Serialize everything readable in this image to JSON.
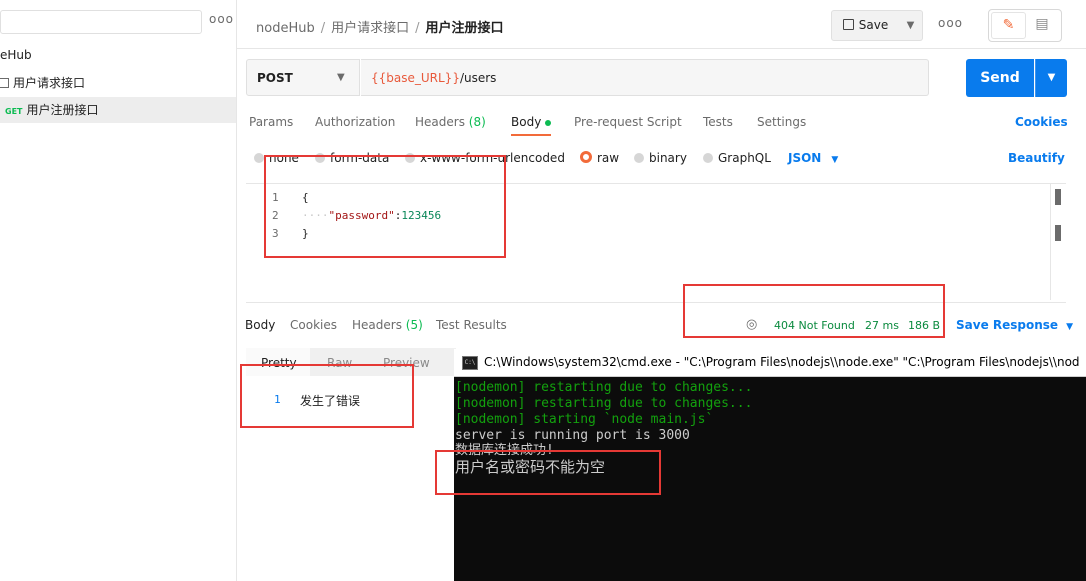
{
  "sidebar": {
    "more_label": "ooo",
    "collection_name": "eHub",
    "folder_name": "用户请求接口",
    "request": {
      "method_tag": "GET",
      "name": "用户注册接口"
    }
  },
  "header": {
    "breadcrumb": [
      "nodeHub",
      "用户请求接口",
      "用户注册接口"
    ],
    "save_label": "Save",
    "more_label": "ooo"
  },
  "request": {
    "method": "POST",
    "url_var": "{{base_URL}}",
    "url_path": "/users",
    "send_label": "Send"
  },
  "tabs": [
    {
      "label": "Params"
    },
    {
      "label": "Authorization"
    },
    {
      "label": "Headers ",
      "count": "(8)"
    },
    {
      "label": "Body"
    },
    {
      "label": "Pre-request Script"
    },
    {
      "label": "Tests"
    },
    {
      "label": "Settings"
    }
  ],
  "cookies_label": "Cookies",
  "body_types": [
    "none",
    "form-data",
    "x-www-form-urlencoded",
    "raw",
    "binary",
    "GraphQL"
  ],
  "body_format": "JSON",
  "beautify_label": "Beautify",
  "editor": {
    "line_numbers": [
      "1",
      "2",
      "3"
    ],
    "lines": {
      "open": "{",
      "indent": "····",
      "key": "\"password\"",
      "colon": ":",
      "value": "123456",
      "close": "}"
    }
  },
  "response": {
    "tabs": [
      {
        "label": "Body"
      },
      {
        "label": "Cookies"
      },
      {
        "label": "Headers ",
        "count": "(5)"
      },
      {
        "label": "Test Results"
      }
    ],
    "status": "404 Not Found",
    "time": "27 ms",
    "size": "186 B",
    "save_response_label": "Save Response",
    "view_modes": [
      "Pretty",
      "Raw",
      "Preview"
    ],
    "body_line_number": "1",
    "body_text": "发生了错误"
  },
  "cmd": {
    "title": "C:\\Windows\\system32\\cmd.exe  - \"C:\\Program Files\\nodejs\\\\node.exe\"   \"C:\\Program Files\\nodejs\\\\nod",
    "lines": [
      "[nodemon] restarting due to changes...",
      "[nodemon] restarting due to changes...",
      "[nodemon] starting `node main.js`",
      "server is running port is 3000",
      "数据库连接成功!",
      "用户名或密码不能为空"
    ]
  },
  "colors": {
    "accent_blue": "#097bed",
    "accent_orange": "#f26b3a",
    "success_green": "#0cbb52",
    "highlight_red": "#e53935"
  }
}
